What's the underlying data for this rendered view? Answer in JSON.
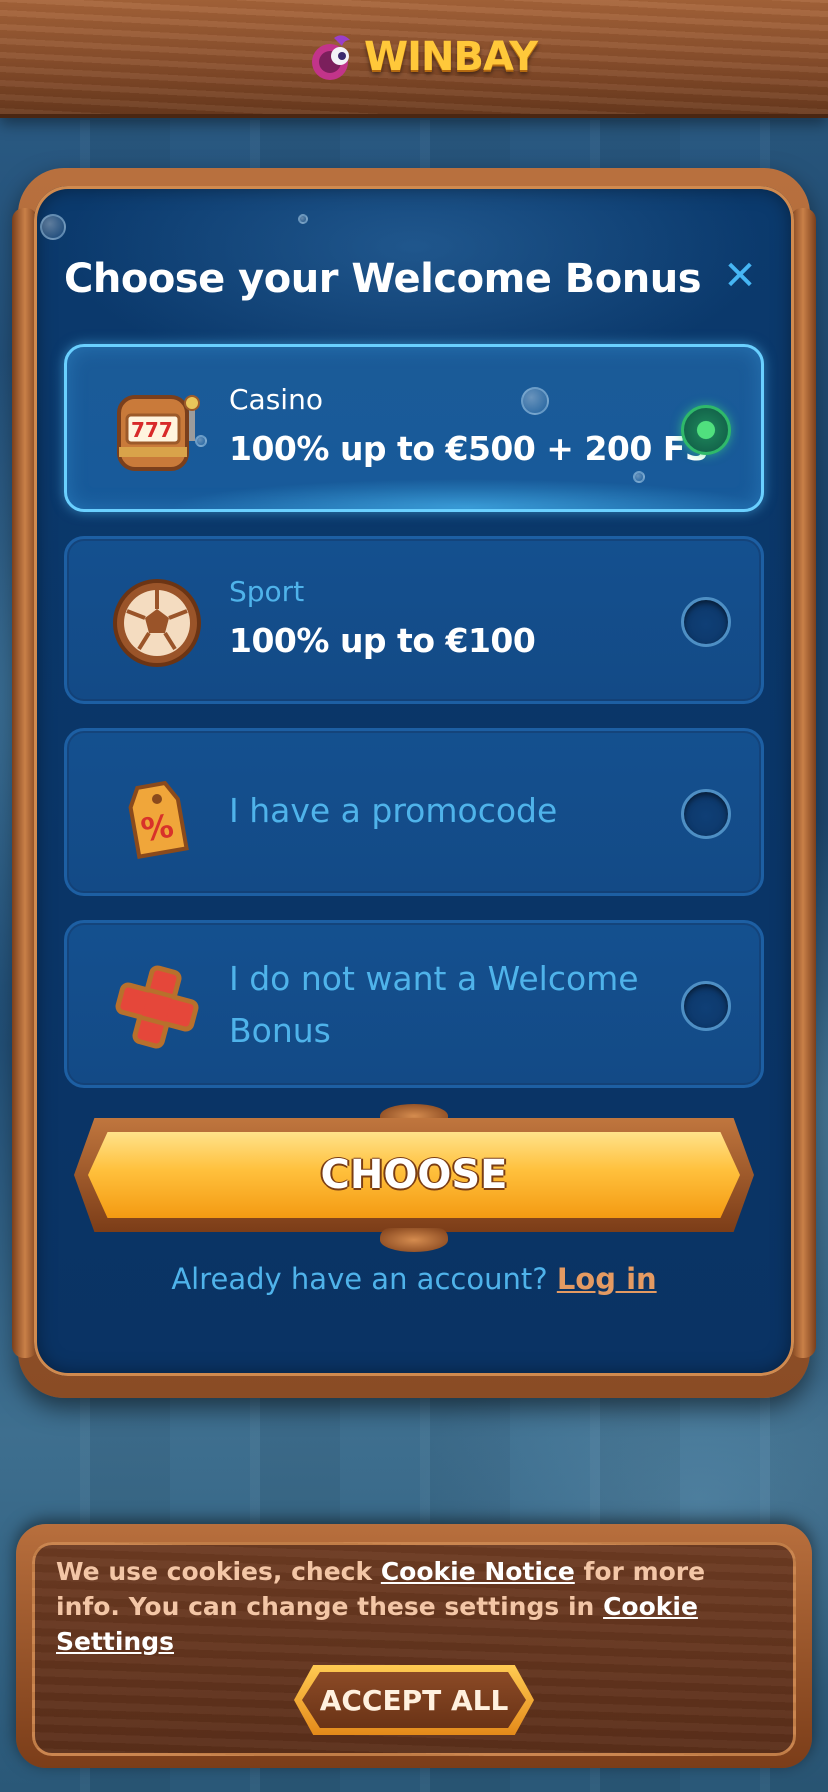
{
  "header": {
    "logo_text": "WINBAY"
  },
  "modal": {
    "title": "Choose your Welcome Bonus",
    "close_icon": "close-icon",
    "options": [
      {
        "category": "Casino",
        "offer": "100% up to €500 + 200 FS",
        "icon": "slot-machine-icon",
        "selected": true
      },
      {
        "category": "Sport",
        "offer": "100% up to €100",
        "icon": "soccer-ball-icon",
        "selected": false
      },
      {
        "label": "I have a promocode",
        "icon": "percent-tag-icon",
        "selected": false
      },
      {
        "label_line1": "I do not want a Welcome",
        "label_line2": "Bonus",
        "icon": "cross-icon",
        "selected": false
      }
    ],
    "choose_label": "CHOOSE",
    "account_prompt": "Already have an account?",
    "login_label": "Log in"
  },
  "cookie": {
    "text_1": "We use cookies, check",
    "cookie_notice_link": "Cookie Notice",
    "text_2": "for more info. You can change these settings in",
    "cookie_settings_link": "Cookie Settings",
    "accept_label": "ACCEPT ALL"
  },
  "colors": {
    "accent_blue": "#4fb3ea",
    "selected_border": "#6ad0ff",
    "radio_checked": "#50e07e",
    "choose_gold": "#ffc03c",
    "login_link": "#e49a62"
  }
}
